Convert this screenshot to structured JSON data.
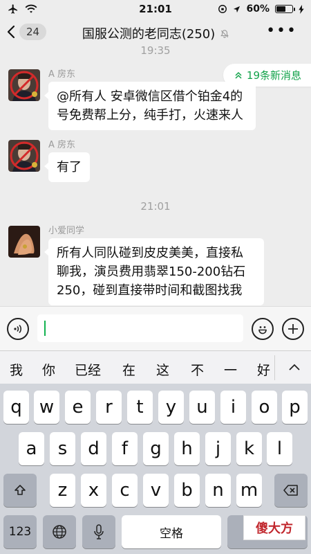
{
  "status": {
    "time": "21:01",
    "battery": "60%",
    "battery_level": 0.6
  },
  "nav": {
    "back_count": "24",
    "title": "国服公测的老同志(250)",
    "mute_icon": "bell-slash-icon",
    "more": "•••"
  },
  "chat": {
    "partial_time": "19:35",
    "new_messages": "19条新消息",
    "time_separator": "21:01",
    "messages": [
      {
        "sender": "A 房东",
        "text_line1": "@所有人 安卓微信区借个铂金4的",
        "text_line2": "号免费帮上分，纯手打，火速来人"
      },
      {
        "sender": "A 房东",
        "text_line1": "有了"
      },
      {
        "sender": "小爱同学",
        "text_line1": "所有人同队碰到皮皮美美，直接私",
        "text_line2": "聊我，演员费用翡翠150-200钻石",
        "text_line3": "250，碰到直接带时间和截图找我"
      }
    ]
  },
  "input": {
    "value": "",
    "voice_icon": "voice-icon",
    "emoji_icon": "emoji-icon",
    "plus_icon": "plus-icon"
  },
  "keyboard": {
    "candidates": [
      "我",
      "你",
      "已经",
      "在",
      "这",
      "不",
      "一",
      "好"
    ],
    "row1": [
      "q",
      "w",
      "e",
      "r",
      "t",
      "y",
      "u",
      "i",
      "o",
      "p"
    ],
    "row2": [
      "a",
      "s",
      "d",
      "f",
      "g",
      "h",
      "j",
      "k",
      "l"
    ],
    "row3": [
      "z",
      "x",
      "c",
      "v",
      "b",
      "n",
      "m"
    ],
    "numbers_key": "123",
    "space_key": "空格"
  },
  "watermark": "傻大方"
}
